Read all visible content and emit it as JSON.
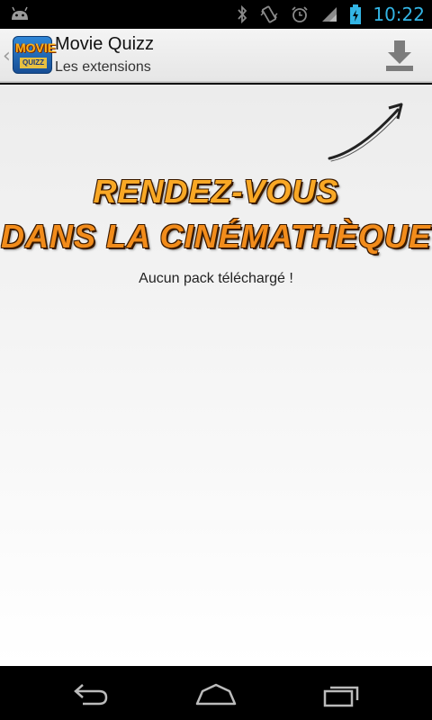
{
  "status_bar": {
    "time": "10:22",
    "icons": [
      "android-icon",
      "bluetooth-icon",
      "vibrate-icon",
      "alarm-icon",
      "signal-icon",
      "battery-charging-icon"
    ],
    "accent": "#33b5e5"
  },
  "action_bar": {
    "title": "Movie Quizz",
    "subtitle": "Les extensions",
    "logo": {
      "word1": "MOVIE",
      "word2": "QUIZZ"
    },
    "download_icon": "download-icon"
  },
  "content": {
    "headline_line1": "RENDEZ-VOUS",
    "headline_line2": "DANS LA CINÉMATHÈQUE",
    "empty_message": "Aucun pack téléchargé !",
    "headline_colors": [
      "#f9a825",
      "#f28c1b"
    ]
  },
  "nav_bar": {
    "buttons": [
      "back-icon",
      "home-icon",
      "recent-apps-icon"
    ]
  }
}
